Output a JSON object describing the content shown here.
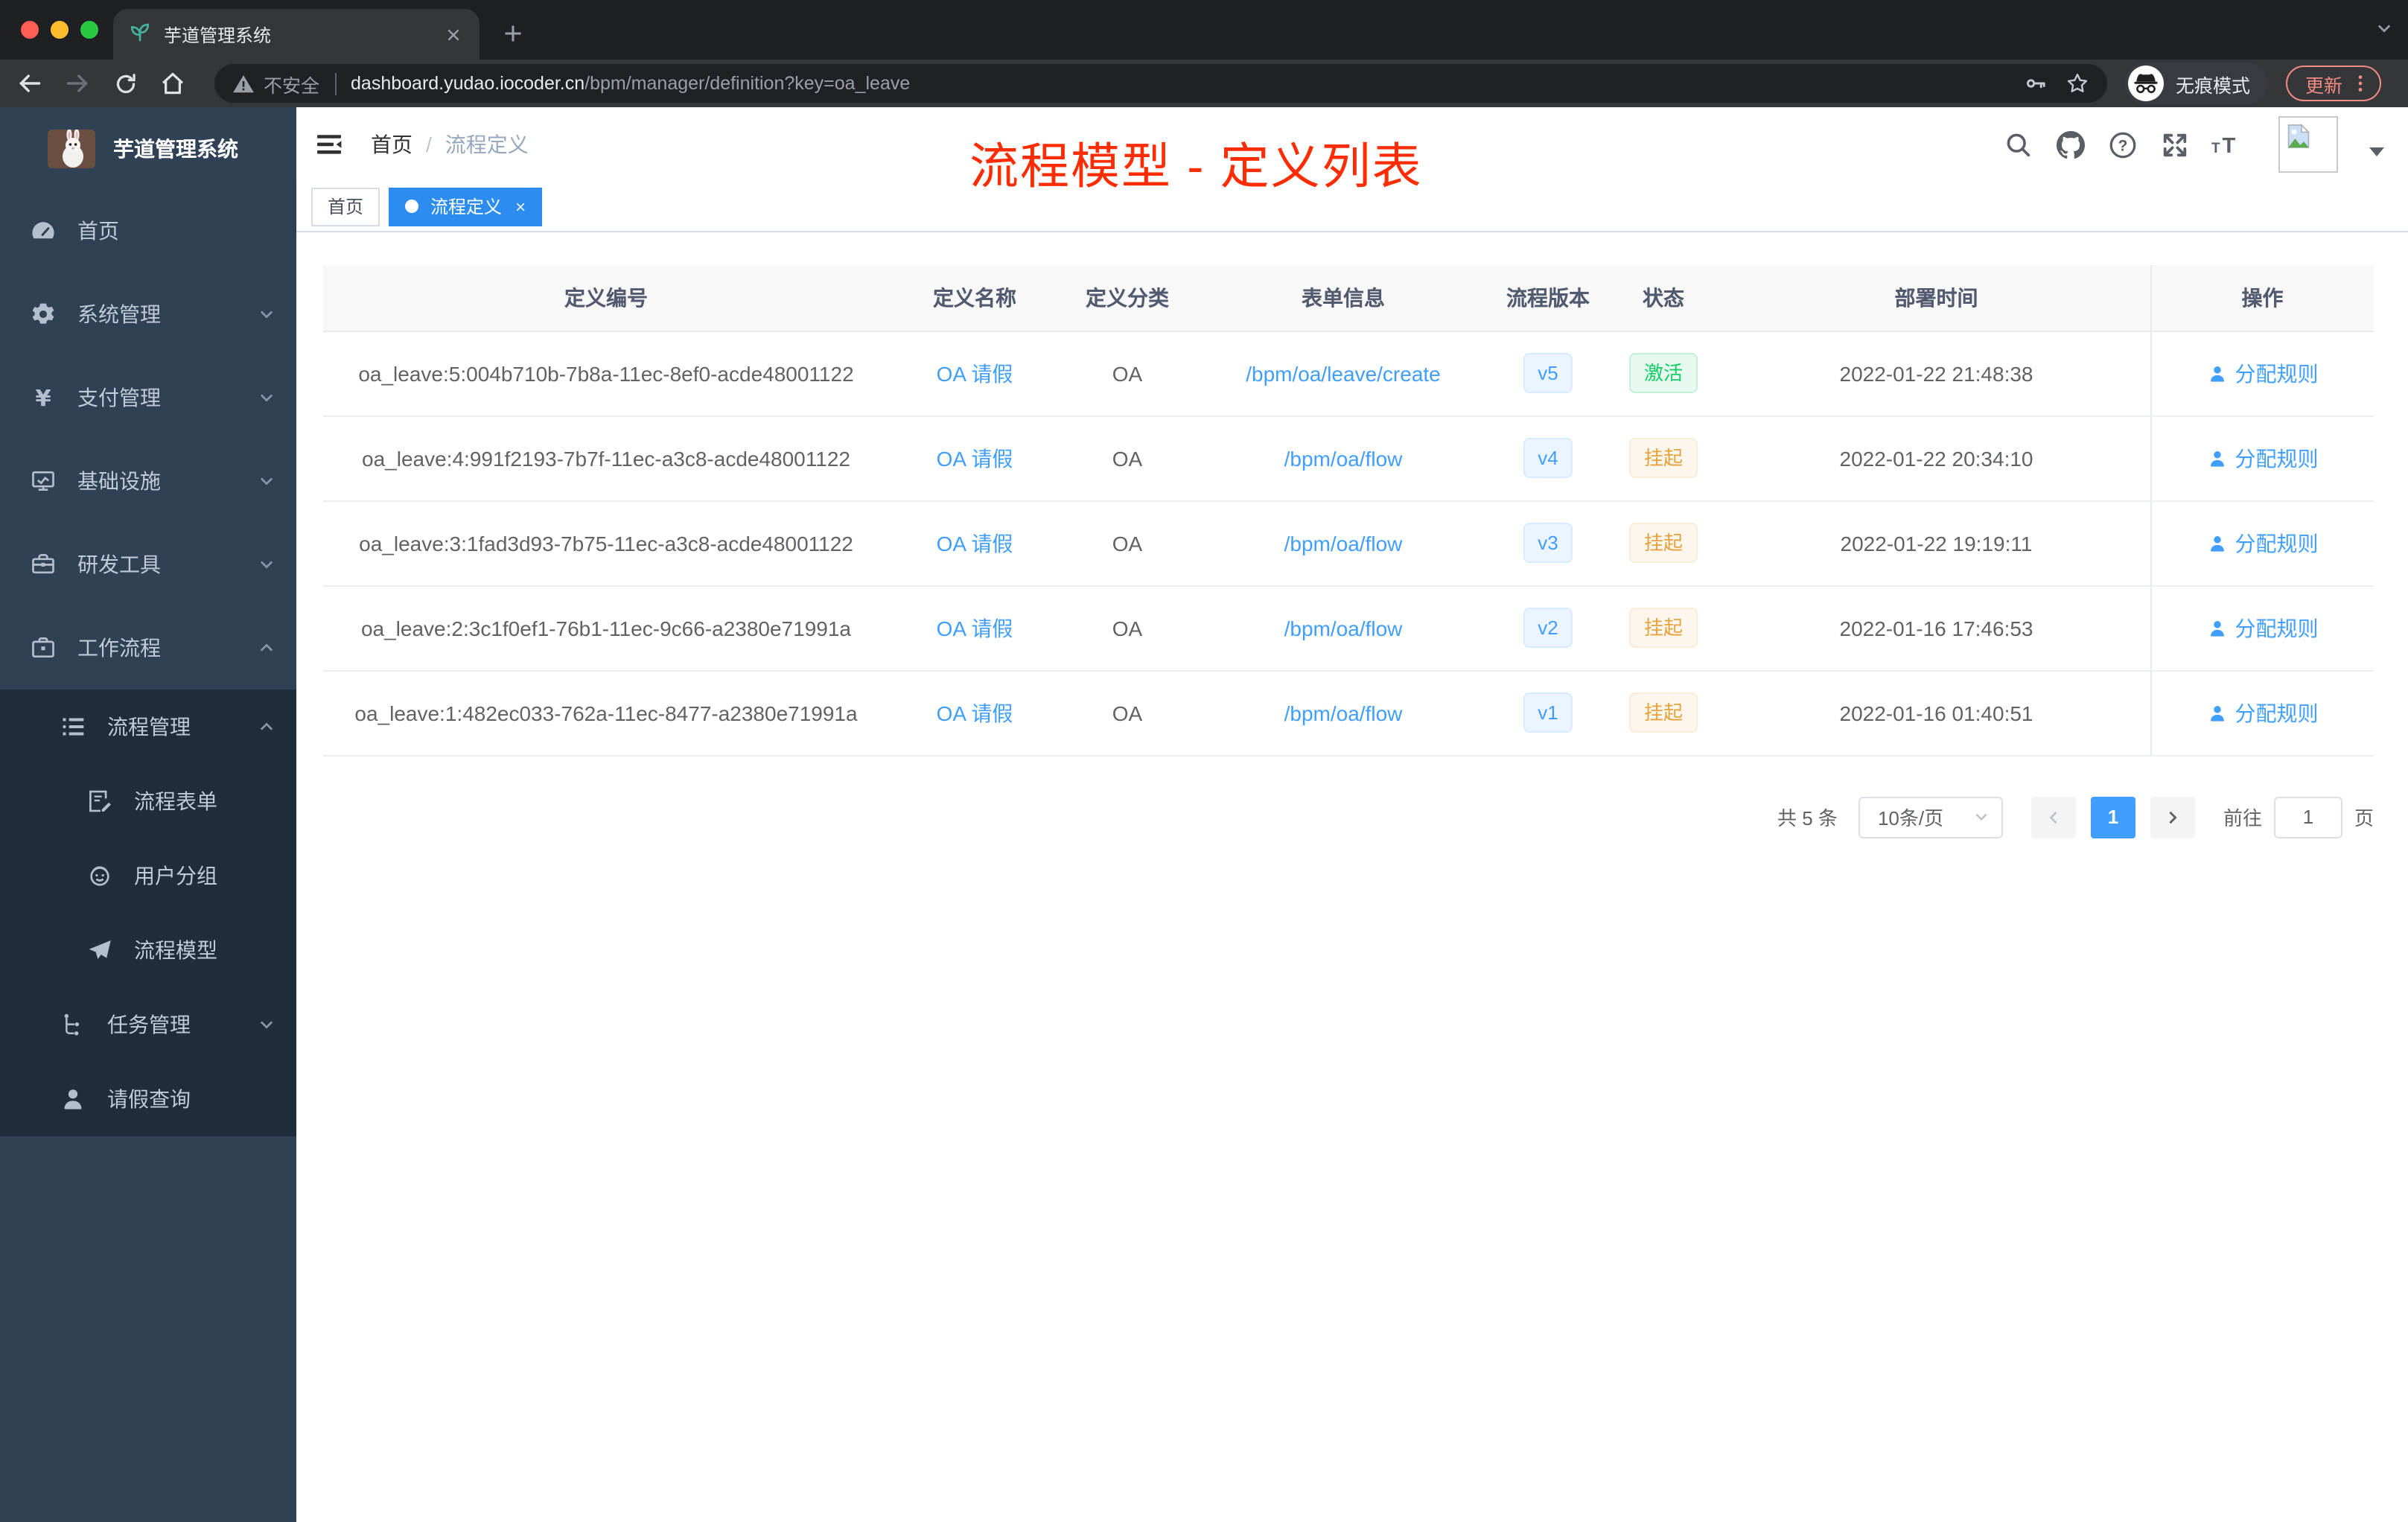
{
  "browser": {
    "tab_title": "芋道管理系统",
    "security_label": "不安全",
    "url_host": "dashboard.yudao.iocoder.cn",
    "url_path": "/bpm/manager/definition?key=oa_leave",
    "incognito_label": "无痕模式",
    "update_label": "更新"
  },
  "sidebar": {
    "logo_title": "芋道管理系统",
    "items": [
      {
        "name": "home",
        "icon": "dashboard-icon",
        "label": "首页",
        "level": 1
      },
      {
        "name": "system-management",
        "icon": "gear-icon",
        "label": "系统管理",
        "level": 1,
        "arrow": "down"
      },
      {
        "name": "payment-management",
        "icon": "yen-icon",
        "label": "支付管理",
        "level": 1,
        "arrow": "down"
      },
      {
        "name": "infrastructure",
        "icon": "monitor-icon",
        "label": "基础设施",
        "level": 1,
        "arrow": "down"
      },
      {
        "name": "dev-tools",
        "icon": "toolbox-icon",
        "label": "研发工具",
        "level": 1,
        "arrow": "down"
      },
      {
        "name": "workflow",
        "icon": "briefcase-icon",
        "label": "工作流程",
        "level": 1,
        "arrow": "up"
      },
      {
        "name": "process-management",
        "icon": "list-icon",
        "label": "流程管理",
        "level": 2,
        "arrow": "up"
      },
      {
        "name": "process-form",
        "icon": "form-icon",
        "label": "流程表单",
        "level": 3
      },
      {
        "name": "user-group",
        "icon": "robot-icon",
        "label": "用户分组",
        "level": 3
      },
      {
        "name": "process-model",
        "icon": "send-icon",
        "label": "流程模型",
        "level": 3
      },
      {
        "name": "task-management",
        "icon": "tree-icon",
        "label": "任务管理",
        "level": 2,
        "arrow": "down"
      },
      {
        "name": "leave-query",
        "icon": "user-icon",
        "label": "请假查询",
        "level": 2
      }
    ]
  },
  "header": {
    "breadcrumb": [
      "首页",
      "流程定义"
    ],
    "annotation": "流程模型 - 定义列表"
  },
  "tags": [
    {
      "label": "首页",
      "active": false
    },
    {
      "label": "流程定义",
      "active": true,
      "closable": true
    }
  ],
  "table": {
    "columns": [
      "定义编号",
      "定义名称",
      "定义分类",
      "表单信息",
      "流程版本",
      "状态",
      "部署时间",
      "操作"
    ],
    "rows": [
      {
        "id": "oa_leave:5:004b710b-7b8a-11ec-8ef0-acde48001122",
        "name": "OA 请假",
        "category": "OA",
        "form": "/bpm/oa/leave/create",
        "version": "v5",
        "status": "激活",
        "status_type": "success",
        "deploy_time": "2022-01-22 21:48:38",
        "action": "分配规则"
      },
      {
        "id": "oa_leave:4:991f2193-7b7f-11ec-a3c8-acde48001122",
        "name": "OA 请假",
        "category": "OA",
        "form": "/bpm/oa/flow",
        "version": "v4",
        "status": "挂起",
        "status_type": "warning",
        "deploy_time": "2022-01-22 20:34:10",
        "action": "分配规则"
      },
      {
        "id": "oa_leave:3:1fad3d93-7b75-11ec-a3c8-acde48001122",
        "name": "OA 请假",
        "category": "OA",
        "form": "/bpm/oa/flow",
        "version": "v3",
        "status": "挂起",
        "status_type": "warning",
        "deploy_time": "2022-01-22 19:19:11",
        "action": "分配规则"
      },
      {
        "id": "oa_leave:2:3c1f0ef1-76b1-11ec-9c66-a2380e71991a",
        "name": "OA 请假",
        "category": "OA",
        "form": "/bpm/oa/flow",
        "version": "v2",
        "status": "挂起",
        "status_type": "warning",
        "deploy_time": "2022-01-16 17:46:53",
        "action": "分配规则"
      },
      {
        "id": "oa_leave:1:482ec033-762a-11ec-8477-a2380e71991a",
        "name": "OA 请假",
        "category": "OA",
        "form": "/bpm/oa/flow",
        "version": "v1",
        "status": "挂起",
        "status_type": "warning",
        "deploy_time": "2022-01-16 01:40:51",
        "action": "分配规则"
      }
    ]
  },
  "pagination": {
    "total": "共 5 条",
    "page_size": "10条/页",
    "current_page": "1",
    "goto_label": "前往",
    "goto_value": "1",
    "unit_label": "页"
  },
  "colors": {
    "primary": "#409eff",
    "tag_active": "#2d8cf0",
    "success": "#13ce66",
    "warning": "#e6a23c",
    "annotation_red": "#fe2c00",
    "sidebar_bg": "#304156",
    "submenu_bg": "#1f2d3d",
    "update_red": "#f28b82"
  }
}
